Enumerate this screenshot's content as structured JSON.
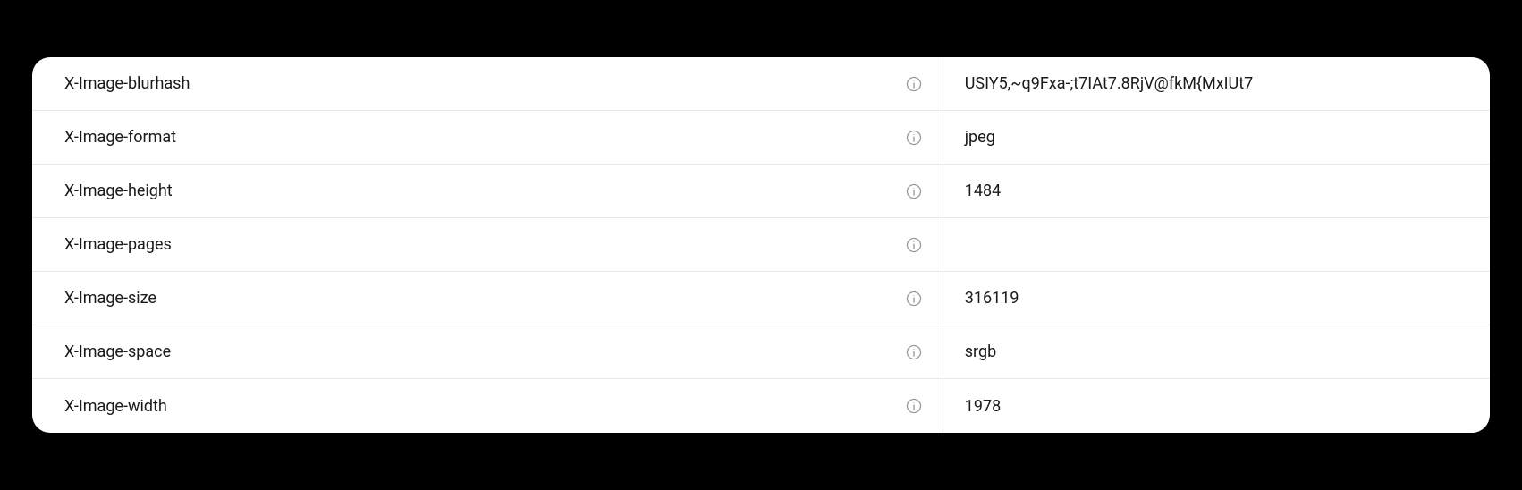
{
  "headers": [
    {
      "key": "X-Image-blurhash",
      "value": "USIY5,~q9Fxa-;t7IAt7.8RjV@fkM{MxIUt7"
    },
    {
      "key": "X-Image-format",
      "value": "jpeg"
    },
    {
      "key": "X-Image-height",
      "value": "1484"
    },
    {
      "key": "X-Image-pages",
      "value": ""
    },
    {
      "key": "X-Image-size",
      "value": "316119"
    },
    {
      "key": "X-Image-space",
      "value": "srgb"
    },
    {
      "key": "X-Image-width",
      "value": "1978"
    }
  ]
}
